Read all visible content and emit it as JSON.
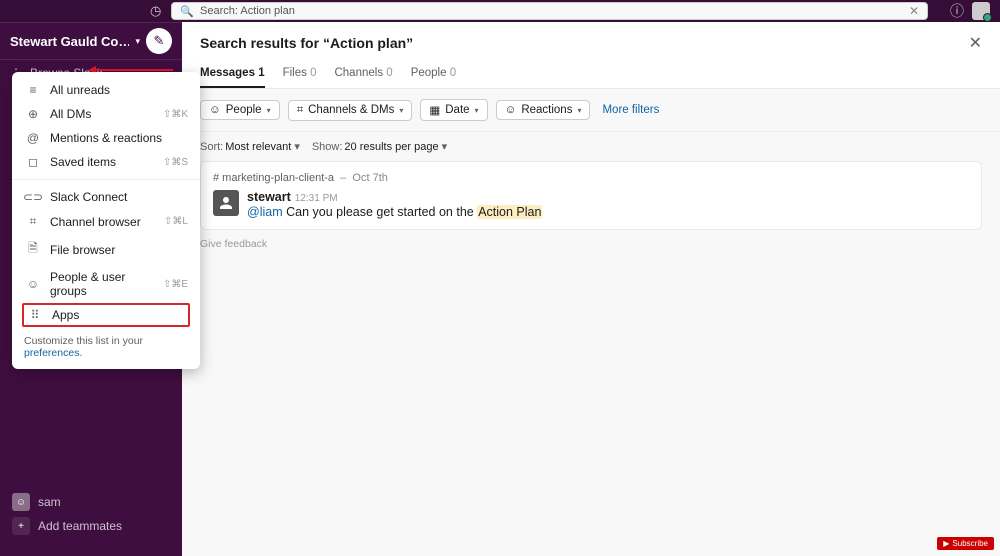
{
  "topbar": {
    "search_prefix": "Search:",
    "search_value": "Action plan"
  },
  "workspace": {
    "name": "Stewart Gauld Co…"
  },
  "browse": {
    "label": "Browse Slack"
  },
  "dropdown": {
    "items": [
      {
        "icon": "≡",
        "label": "All unreads",
        "shortcut": ""
      },
      {
        "icon": "⊕",
        "label": "All DMs",
        "shortcut": "⇧⌘K"
      },
      {
        "icon": "@",
        "label": "Mentions & reactions",
        "shortcut": ""
      },
      {
        "icon": "◻",
        "label": "Saved items",
        "shortcut": "⇧⌘S"
      }
    ],
    "items2": [
      {
        "icon": "⊂⊃",
        "label": "Slack Connect",
        "shortcut": ""
      },
      {
        "icon": "⌗",
        "label": "Channel browser",
        "shortcut": "⇧⌘L"
      },
      {
        "icon": "🗎",
        "label": "File browser",
        "shortcut": ""
      },
      {
        "icon": "☺",
        "label": "People & user groups",
        "shortcut": "⇧⌘E"
      }
    ],
    "apps": {
      "icon": "⠿",
      "label": "Apps"
    },
    "footer_prefix": "Customize this list in your ",
    "footer_link": "preferences."
  },
  "sidebar_bottom": {
    "user": "sam",
    "add": "Add teammates"
  },
  "results": {
    "heading": "Search results for “Action plan”",
    "tabs": [
      {
        "label": "Messages",
        "count": "1"
      },
      {
        "label": "Files",
        "count": "0"
      },
      {
        "label": "Channels",
        "count": "0"
      },
      {
        "label": "People",
        "count": "0"
      }
    ],
    "filters": {
      "people": "People",
      "channels": "Channels & DMs",
      "date": "Date",
      "reactions": "Reactions",
      "more": "More filters"
    },
    "sort": {
      "label": "Sort:",
      "value": "Most relevant",
      "show_label": "Show:",
      "show_value": "20 results per page"
    },
    "msg": {
      "channel": "# marketing-plan-client-a",
      "date": "Oct 7th",
      "author": "stewart",
      "time": "12:31 PM",
      "mention": "@liam",
      "text_before": "Can you please get started on the ",
      "text_hl": "Action Plan"
    },
    "feedback": "Give feedback"
  },
  "youtube": "Subscribe"
}
